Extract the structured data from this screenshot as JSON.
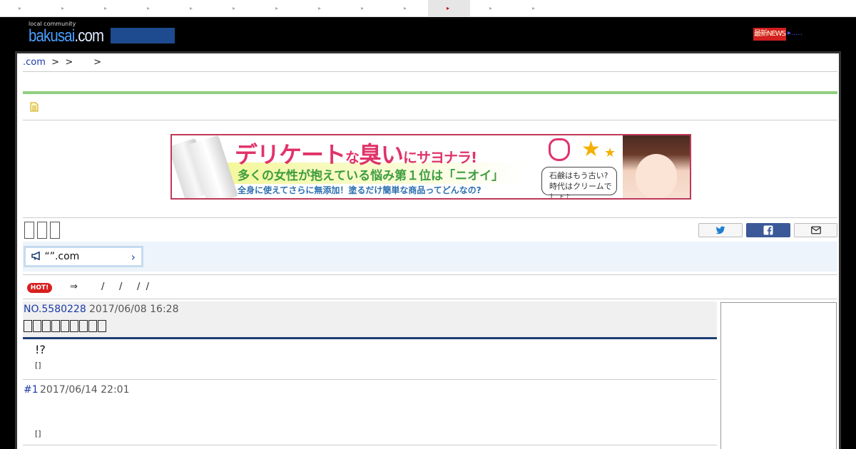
{
  "top_nav": {
    "items": [
      "▸",
      "▸",
      "▸",
      "▸",
      "▸",
      "▸",
      "▸",
      "▸",
      "▸",
      "▸",
      "▸",
      "▸",
      "▸"
    ],
    "active_index": 10
  },
  "header": {
    "logo_small": "local community",
    "logo_name_1": "bakusai",
    "logo_name_2": ".com",
    "news_badge": "最新NEWS",
    "news_dots": "▸....."
  },
  "breadcrumb": {
    "site": ".com",
    "separators": "  >  >       >"
  },
  "banner": {
    "headline_1": "デリケート",
    "headline_2": "な",
    "headline_3": "臭い",
    "headline_4": "にサヨナラ!",
    "sub_1": "多くの女性が抱えている悩み第１位は「ニオイ」",
    "sub_2": "全身に使えてさらに無添加！塗るだけ簡単な商品ってどんなの?",
    "bubble_1": "石鹸はもう古い?",
    "bubble_2": "時代はクリームでしょ♪"
  },
  "notice": {
    "label": "“”.com",
    "chevron": "›"
  },
  "hot": {
    "badge": "HOT!",
    "links": "⇒        /     /     /  /"
  },
  "post": {
    "number": "NO.5580228",
    "date": "2017/06/08 16:28",
    "body": "!?",
    "meta": "[]"
  },
  "reply": {
    "number": "#1",
    "date": "2017/06/14 22:01",
    "meta": "[]"
  },
  "colors": {
    "accent_green": "#8fcf7f",
    "title_rule": "#1d3e73",
    "link_blue": "#1a3aa8",
    "hot_red": "#d81f1f"
  }
}
